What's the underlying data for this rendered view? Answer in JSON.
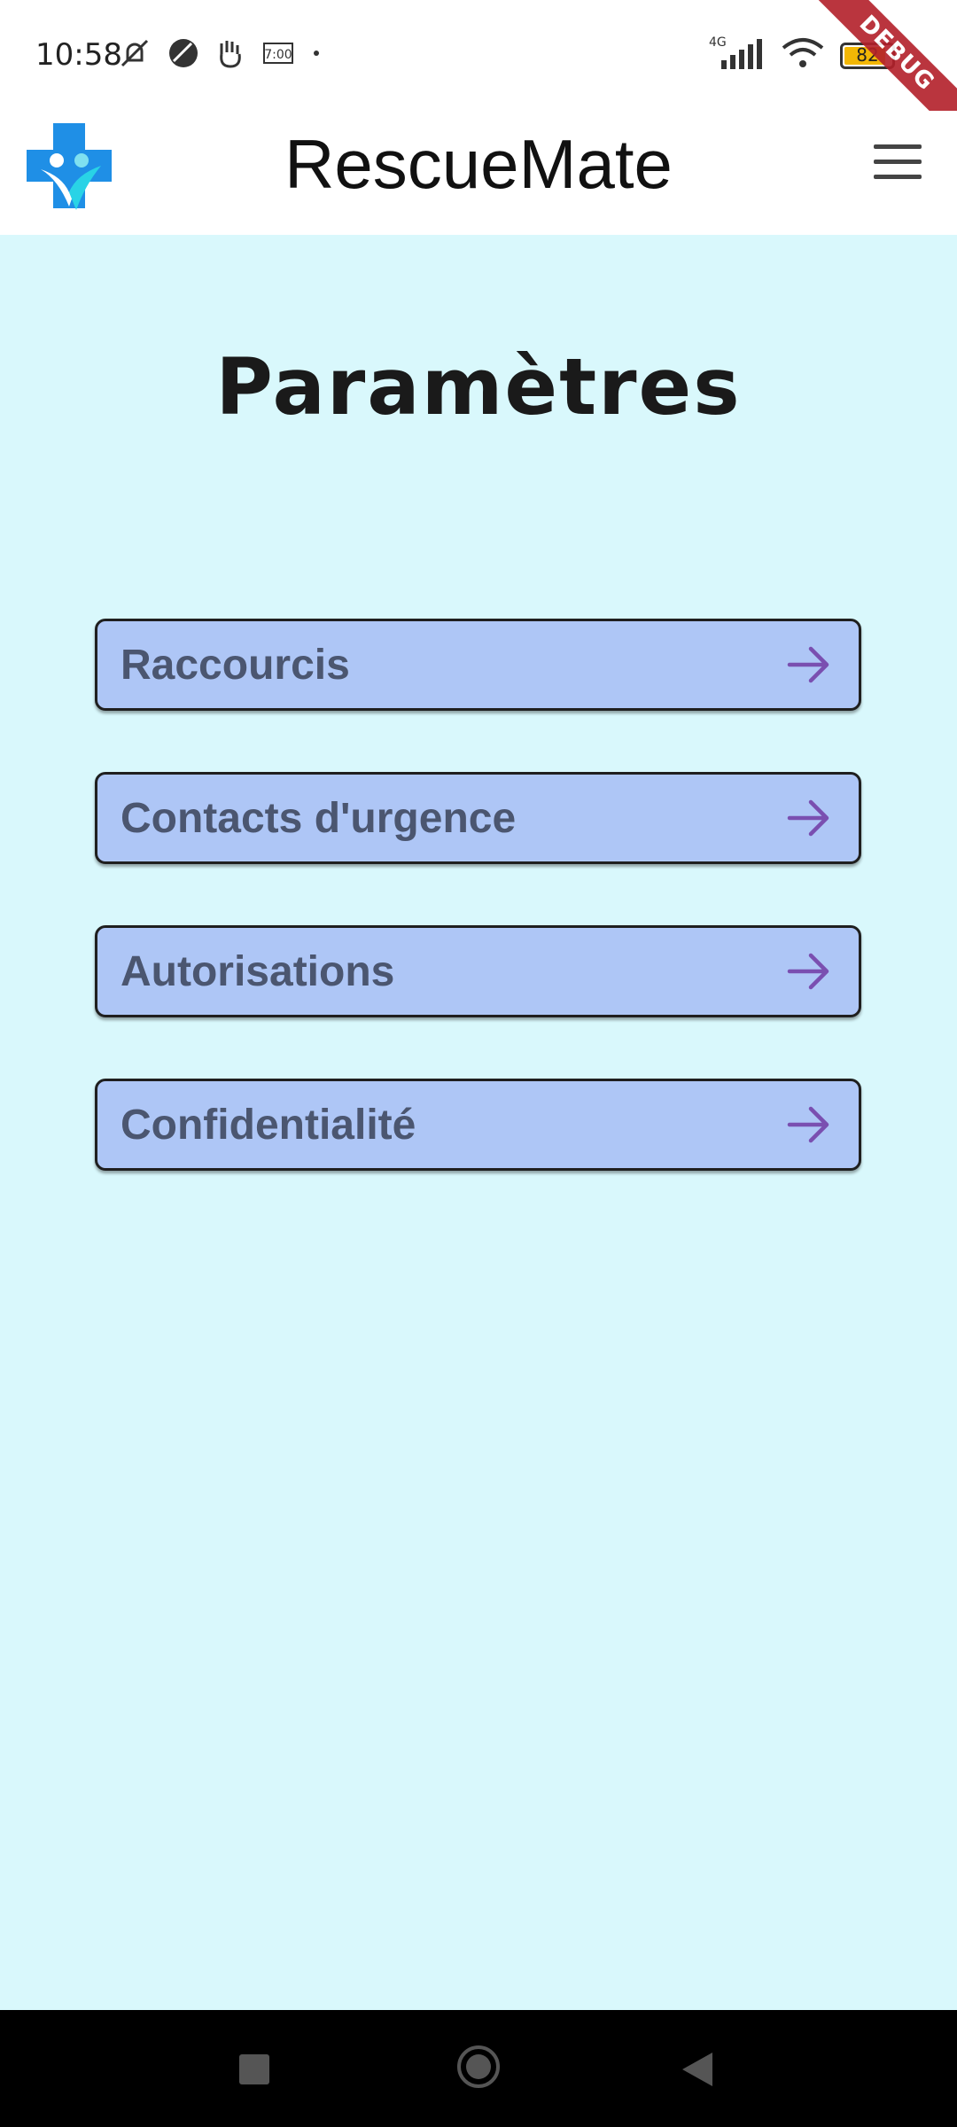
{
  "status_bar": {
    "time": "10:58",
    "network": "4G",
    "battery": "82",
    "icons_left": [
      "mute-icon",
      "moon-icon",
      "hand-icon",
      "alarm-icon",
      "dot-icon"
    ],
    "icons_right": [
      "signal-icon",
      "wifi-icon",
      "battery-icon"
    ],
    "battery_level": 0.82
  },
  "debug_banner": "DEBUG",
  "app_bar": {
    "title": "RescueMate",
    "logo_icon": "rescuemate-logo",
    "menu_icon": "hamburger-menu-icon"
  },
  "page": {
    "title": "Paramètres",
    "items": [
      {
        "label": "Raccourcis",
        "icon": "arrow-right-icon"
      },
      {
        "label": "Contacts d'urgence",
        "icon": "arrow-right-icon"
      },
      {
        "label": "Autorisations",
        "icon": "arrow-right-icon"
      },
      {
        "label": "Confidentialité",
        "icon": "arrow-right-icon"
      }
    ]
  },
  "colors": {
    "content_bg": "#d9f8fc",
    "item_bg": "#aec6f6",
    "item_text": "#4b5670",
    "arrow": "#7a4fb0",
    "logo_blue": "#1f8fe6",
    "debug_ribbon": "#b3202a"
  }
}
